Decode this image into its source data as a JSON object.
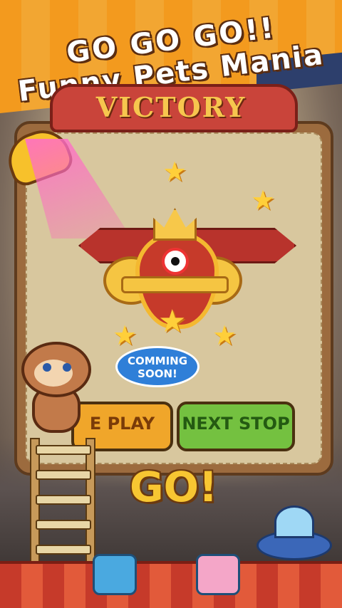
{
  "promo": {
    "line1": "GO GO GO!!",
    "line2": "Funny Pets Mania"
  },
  "popup": {
    "title": "VICTORY",
    "badge": {
      "line1": "COMMING",
      "line2": "SOON!"
    },
    "buttons": {
      "replay": "E PLAY",
      "next": "NEXT STOP"
    }
  },
  "go_label": "GO!",
  "icons": [
    "spotlight-icon",
    "medal-icon",
    "crown-icon",
    "star-icon",
    "squirrel-icon",
    "ladder-icon",
    "ufo-icon"
  ],
  "colors": {
    "banner_orange": "#f39a1e",
    "ribbon_red": "#c9443a",
    "replay_button": "#f0a62a",
    "next_button": "#74c140",
    "go_yellow": "#f7c632"
  }
}
